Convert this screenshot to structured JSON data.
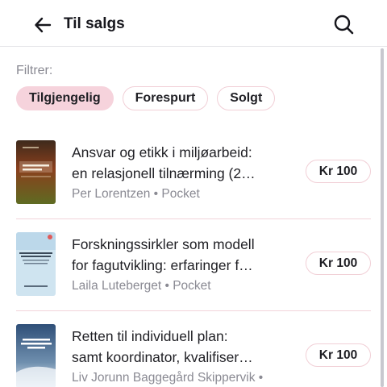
{
  "header": {
    "title": "Til salgs",
    "back_icon": "arrow-left-icon",
    "search_icon": "search-icon"
  },
  "filters": {
    "label": "Filtrer:",
    "chips": [
      {
        "label": "Tilgjengelig",
        "active": true
      },
      {
        "label": "Forespurt",
        "active": false
      },
      {
        "label": "Solgt",
        "active": false
      }
    ]
  },
  "items": [
    {
      "title_line1": "Ansvar og etikk i miljøarbeid:",
      "title_line2": "en relasjonell tilnærming (2…",
      "meta": "Per Lorentzen • Pocket",
      "price": "Kr 100",
      "cover_color": "#7a3a1e",
      "cover_title": "Ansvar og etikk i miljøarbeid",
      "cover_author": "Per Lorentzen"
    },
    {
      "title_line1": "Forskningssirkler som modell",
      "title_line2": "for fagutvikling: erfaringer f…",
      "meta": "Laila Luteberget • Pocket",
      "price": "Kr 100",
      "cover_color": "#cfe3ef",
      "cover_title": "Forskningssirkler som modell for fagutvikling",
      "cover_author": ""
    },
    {
      "title_line1": "Retten til individuell plan:",
      "title_line2": "samt koordinator, kvalifiser…",
      "meta": "Liv Jorunn Baggegård Skippervik •",
      "price": "Kr 100",
      "cover_color": "#3d5f86",
      "cover_title": "RETTEN TIL INDIVIDUELL PLAN",
      "cover_author": ""
    }
  ],
  "colors": {
    "accent_pink": "#f6d3dc",
    "border_pink": "#f1cfd6",
    "muted_text": "#8a8a93"
  }
}
